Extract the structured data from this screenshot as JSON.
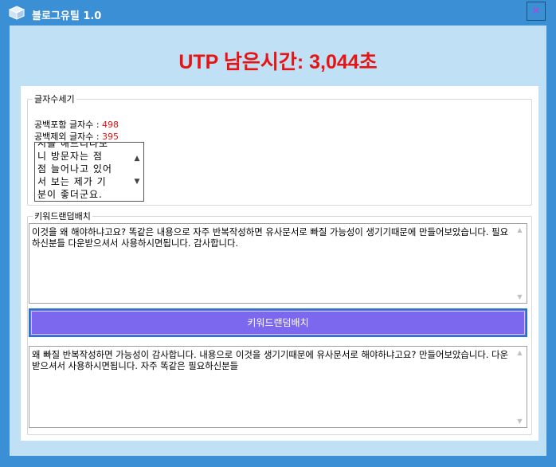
{
  "window": {
    "title": "블로그유틸 1.0",
    "close_label": "×"
  },
  "utp": {
    "text": "UTP 남은시간: 3,044초"
  },
  "char_count": {
    "legend": "글자수세기",
    "with_spaces_label": "공백포함 글자수 :",
    "with_spaces_value": "498",
    "without_spaces_label": "공백제외 글자수 :",
    "without_spaces_value": "395",
    "preview_text": "시를 해드리다보\n니 방문자는 점\n점 늘어나고 있어\n서 보는 제가 기\n분이 좋더군요."
  },
  "keyword_shuffle": {
    "legend": "키워드랜덤배치",
    "input_text": "이것을 왜 해야하냐고요? 똑같은 내용으로 자주 반복작성하면 유사문서로 빠질 가능성이 생기기때문에 만들어보았습니다. 필요하신분들 다운받으셔서 사용하시면됩니다. 감사합니다.",
    "button_label": "키워드랜덤배치",
    "output_text": "왜 빠질 반복작성하면 가능성이 감사합니다. 내용으로 이것을 생기기때문에 유사문서로 해야하냐고요? 만들어보았습니다. 다운받으셔서 사용하시면됩니다. 자주 똑같은 필요하신분들"
  },
  "colors": {
    "titlebar": "#3b8fd4",
    "client": "#bfe0f5",
    "utp_text": "#e81313",
    "button": "#7b68ee"
  }
}
